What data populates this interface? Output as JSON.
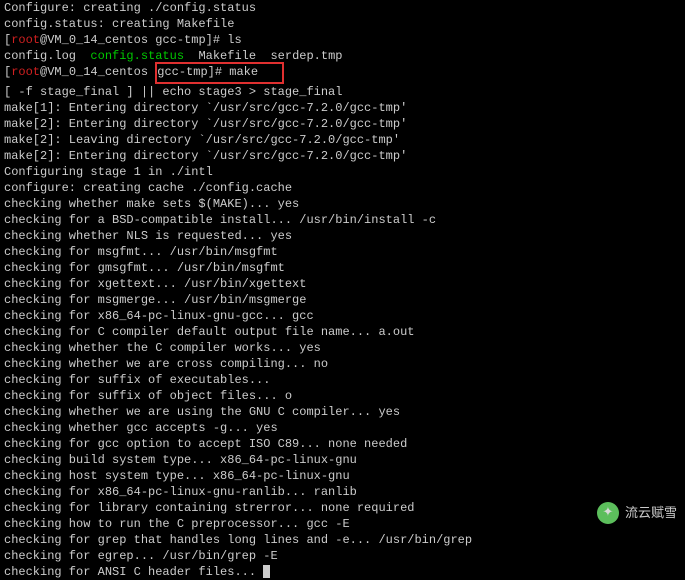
{
  "prompt": {
    "user": "root",
    "host": "VM_0_14_centos",
    "cwd": "gcc-tmp",
    "open": "[",
    "at": "@",
    "close": "]# "
  },
  "cmd_ls": "ls",
  "cmd_make": "make",
  "files": {
    "f1": "config.log",
    "f2": "config.status",
    "f3": "Makefile",
    "f4": "serdep.tmp"
  },
  "lines": {
    "l0": "Configure: creating ./config.status",
    "l1": "config.status: creating Makefile",
    "l5a": "[ -f stage_final ] || echo stage3",
    "l5b": " > stage_final",
    "l6": "make[1]: Entering directory `/usr/src/gcc-7.2.0/gcc-tmp'",
    "l7": "make[2]: Entering directory `/usr/src/gcc-7.2.0/gcc-tmp'",
    "l8": "make[2]: Leaving directory `/usr/src/gcc-7.2.0/gcc-tmp'",
    "l9": "make[2]: Entering directory `/usr/src/gcc-7.2.0/gcc-tmp'",
    "l10": "Configuring stage 1 in ./intl",
    "l11": "configure: creating cache ./config.cache",
    "l12": "checking whether make sets $(MAKE)... yes",
    "l13": "checking for a BSD-compatible install... /usr/bin/install -c",
    "l14": "checking whether NLS is requested... yes",
    "l15": "checking for msgfmt... /usr/bin/msgfmt",
    "l16": "checking for gmsgfmt... /usr/bin/msgfmt",
    "l17": "checking for xgettext... /usr/bin/xgettext",
    "l18": "checking for msgmerge... /usr/bin/msgmerge",
    "l19": "checking for x86_64-pc-linux-gnu-gcc... gcc",
    "l20": "checking for C compiler default output file name... a.out",
    "l21": "checking whether the C compiler works... yes",
    "l22": "checking whether we are cross compiling... no",
    "l23": "checking for suffix of executables...",
    "l24": "checking for suffix of object files... o",
    "l25": "checking whether we are using the GNU C compiler... yes",
    "l26": "checking whether gcc accepts -g... yes",
    "l27": "checking for gcc option to accept ISO C89... none needed",
    "l28": "checking build system type... x86_64-pc-linux-gnu",
    "l29": "checking host system type... x86_64-pc-linux-gnu",
    "l30": "checking for x86_64-pc-linux-gnu-ranlib... ranlib",
    "l31": "checking for library containing strerror... none required",
    "l32": "checking how to run the C preprocessor... gcc -E",
    "l33": "checking for grep that handles long lines and -e... /usr/bin/grep",
    "l34": "checking for egrep... /usr/bin/grep -E",
    "l35": "checking for ANSI C header files... "
  },
  "watermark": {
    "text": "流云赋雪",
    "icon": "✦"
  }
}
